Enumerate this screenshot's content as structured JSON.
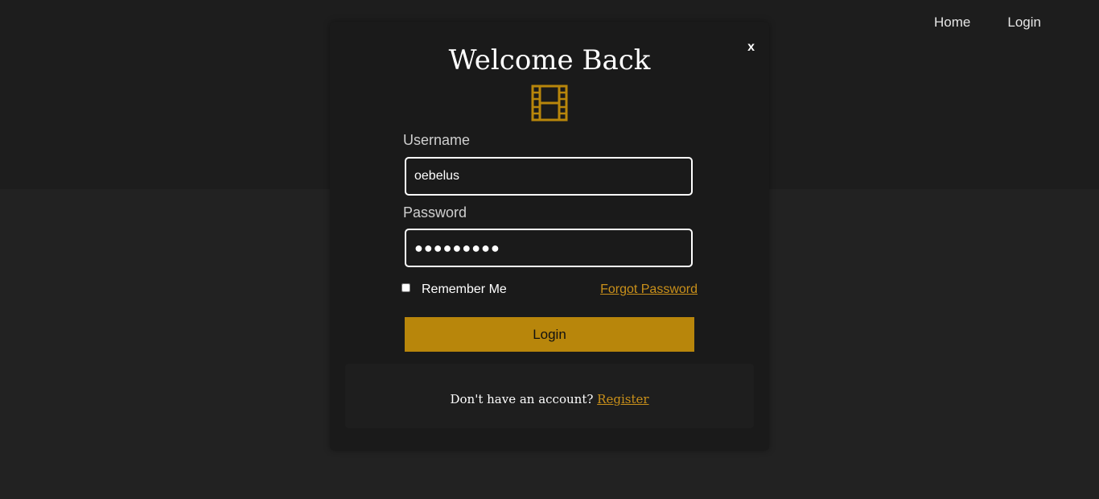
{
  "nav": {
    "home_label": "Home",
    "login_label": "Login"
  },
  "modal": {
    "title": "Welcome Back",
    "close_label": "x",
    "icon": "film-icon",
    "username": {
      "label": "Username",
      "value": "oebelus"
    },
    "password": {
      "label": "Password",
      "value": "●●●●●●●●●"
    },
    "remember_label": "Remember Me",
    "remember_checked": false,
    "forgot_label": "Forgot Password",
    "login_button_label": "Login",
    "footer": {
      "prompt": "Don't have an account?",
      "register_label": "Register"
    }
  },
  "colors": {
    "accent": "#b8860b",
    "link": "#c9901a",
    "background": "#222222",
    "modal_background": "#1a1a1a"
  }
}
